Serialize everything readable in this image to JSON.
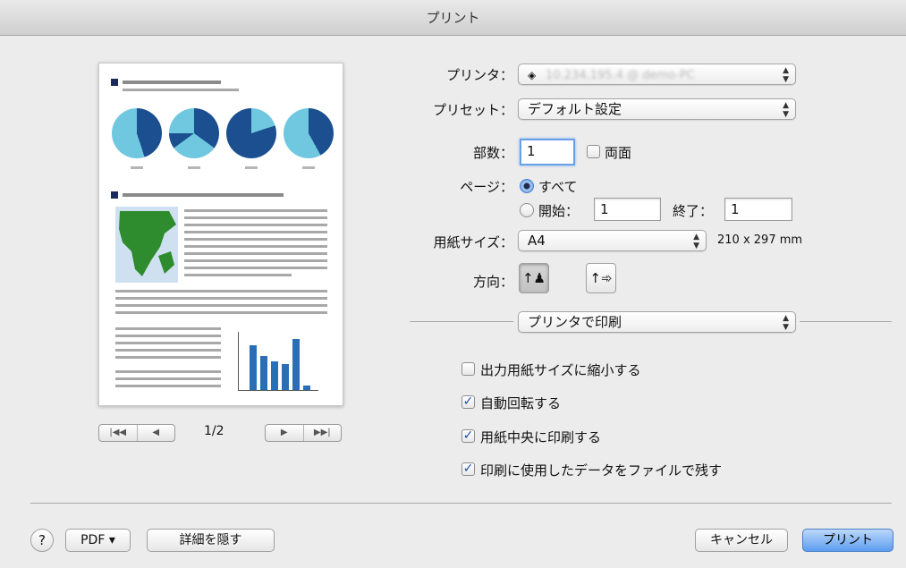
{
  "window": {
    "title": "プリント"
  },
  "preview": {
    "page_indicator": "1/2",
    "first_glyph": "|◀◀",
    "prev_glyph": "◀",
    "next_glyph": "▶",
    "last_glyph": "▶▶|"
  },
  "form": {
    "printer": {
      "label": "プリンタ：",
      "value": "10.234.195.4 @ demo-PC"
    },
    "preset": {
      "label": "プリセット：",
      "value": "デフォルト設定"
    },
    "copies": {
      "label": "部数：",
      "value": "1",
      "duplex_label": "両面",
      "duplex_checked": false
    },
    "pages": {
      "label": "ページ：",
      "all_label": "すべて",
      "range_label": "開始：",
      "from_value": "1",
      "to_label": "終了：",
      "to_value": "1"
    },
    "paper": {
      "label": "用紙サイズ：",
      "value": "A4",
      "dimensions": "210 x 297 mm"
    },
    "orientation": {
      "label": "方向：",
      "selected": "portrait"
    },
    "section_popup": "プリンタで印刷",
    "options": [
      {
        "label": "出力用紙サイズに縮小する",
        "checked": false
      },
      {
        "label": "自動回転する",
        "checked": true
      },
      {
        "label": "用紙中央に印刷する",
        "checked": true
      },
      {
        "label": "印刷に使用したデータをファイルで残す",
        "checked": true
      }
    ]
  },
  "footer": {
    "help": "?",
    "pdf": "PDF ▾",
    "hide_details": "詳細を隠す",
    "cancel": "キャンセル",
    "print": "プリント"
  },
  "colors": {
    "accent": "#5d9df0",
    "pie_dark": "#1b4f8f",
    "pie_light": "#6fc8e0",
    "map_green": "#2e8b2e"
  }
}
